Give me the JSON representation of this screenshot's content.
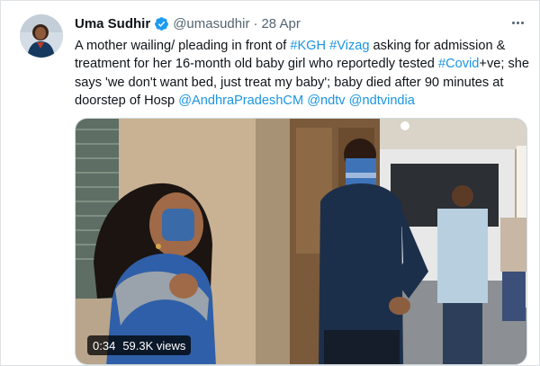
{
  "tweet": {
    "author": {
      "display_name": "Uma Sudhir",
      "handle": "@umasudhir",
      "verified": true
    },
    "date": "28 Apr",
    "separator": "·",
    "text_segments": [
      {
        "text": "A mother wailing/ pleading in front of ",
        "type": "text"
      },
      {
        "text": "#KGH",
        "type": "hashtag"
      },
      {
        "text": " ",
        "type": "text"
      },
      {
        "text": "#Vizag",
        "type": "hashtag"
      },
      {
        "text": " asking for admission & treatment for her 16-month old baby girl who reportedly tested ",
        "type": "text"
      },
      {
        "text": "#Covid",
        "type": "hashtag"
      },
      {
        "text": "+ve; she says 'we don't want bed, just treat my baby'; baby died after 90 minutes at doorstep of Hosp ",
        "type": "text"
      },
      {
        "text": "@AndhraPradeshCM",
        "type": "mention"
      },
      {
        "text": " ",
        "type": "text"
      },
      {
        "text": "@ndtv",
        "type": "mention"
      },
      {
        "text": " ",
        "type": "text"
      },
      {
        "text": "@ndtvindia",
        "type": "mention"
      }
    ],
    "video": {
      "duration": "0:34",
      "views": "59.3K views"
    }
  },
  "icons": {
    "verified": "verified-badge-icon",
    "more": "more-options-icon"
  },
  "colors": {
    "link": "#1b95e0",
    "verified": "#1d9bf0",
    "secondary_text": "#536471"
  }
}
